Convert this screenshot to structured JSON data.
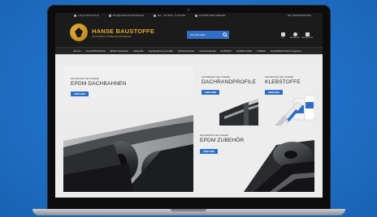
{
  "topbar": {
    "items": [
      "+49 (0) 4161 64 66 26",
      "INFO@HANSE-BAUSTOFFE.DE",
      "MO. - FR. 08:00 - 17:00 UHR",
      "KOSTENLOSER VERSAND"
    ],
    "right": "DE | VERSANDKOSTEN"
  },
  "logo": {
    "title": "HANSE BAUSTOFFE",
    "subtitle": "FACHHANDEL FÜR BEDACHUNGSBEDARF"
  },
  "search": {
    "placeholder": "SUCHE HIER"
  },
  "header_icons": [
    {
      "icon": "language-icon",
      "label": "DE"
    },
    {
      "icon": "account-icon",
      "label": "ANMELDEN"
    },
    {
      "icon": "cart-icon",
      "label": "WARENKORB"
    }
  ],
  "nav": {
    "items": [
      "Service",
      "ALLE PRODUKTE",
      "EPDM Dachbahn",
      "Klebstoffe",
      "Dachbegrünung Gefälle",
      "EPDM Zubehör",
      "Dachrandprofile",
      "KONTAKT",
      "DOWNLOADS",
      "VIDEOS",
      "DACHPRAKTISCH Angebote"
    ]
  },
  "tiles": {
    "epdm": {
      "eyebrow": "ENTDECKEN SIE UNSERE",
      "heading": "EPDM DACHBAHNEN",
      "cta": "SHOP NOW"
    },
    "dach": {
      "eyebrow": "ENTDECKEN SIE UNSERE",
      "heading": "DACHRANDPROFILE",
      "cta": "SHOP NOW"
    },
    "kleb": {
      "eyebrow": "ENTDECKEN SIE UNSERE",
      "heading": "KLEBSTOFFE",
      "cta": "SHOP NOW"
    },
    "zub": {
      "eyebrow": "ENTDECKEN SIE UNSERE",
      "heading": "EPDM ZUBEHÖR",
      "cta": "SHOP NOW"
    }
  },
  "colors": {
    "background_blue": "#1f6fc6",
    "header_dark": "#1b1b1b",
    "logo_gold": "#e0a830",
    "cta_blue": "#2e6fc4"
  }
}
